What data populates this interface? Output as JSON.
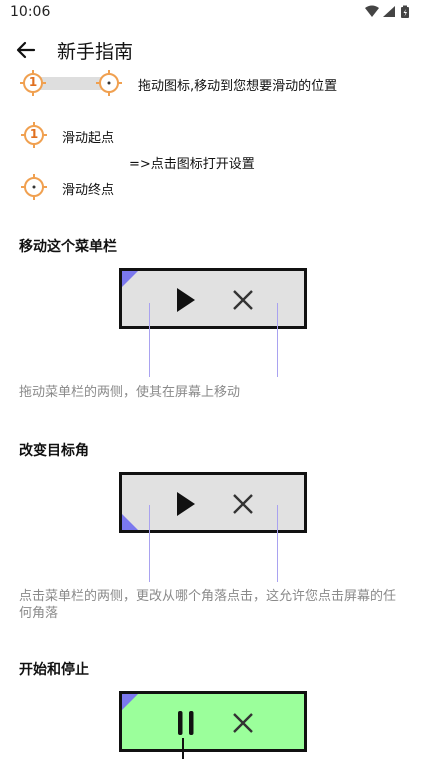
{
  "status_bar": {
    "time": "10:06"
  },
  "appbar": {
    "title": "新手指南"
  },
  "target_demo": {
    "start_number": "1",
    "drag_instruction": "拖动图标,移动到您想要滑动的位置"
  },
  "legend": {
    "start_number": "1",
    "start_label": "滑动起点",
    "end_label": "滑动终点",
    "open_settings": "=>点击图标打开设置"
  },
  "section_move": {
    "title": "移动这个菜单栏",
    "caption": "拖动菜单栏的两侧，使其在屏幕上移动"
  },
  "section_corner": {
    "title": "改变目标角",
    "caption_line1": "点击菜单栏的两侧，更改从哪个角落点击，这允许您点击屏幕的任",
    "caption_line2": "何角落"
  },
  "section_startstop": {
    "title": "开始和停止"
  },
  "colors": {
    "target_orange": "#f0a050",
    "corner_purple": "#7b78ee",
    "bar_gray": "#e1e1e1",
    "bar_green": "#9bff9b"
  }
}
